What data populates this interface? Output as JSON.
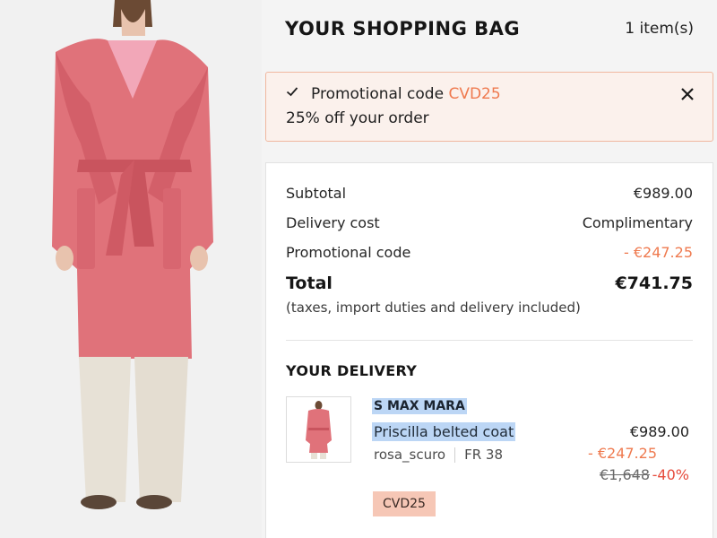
{
  "header": {
    "title": "YOUR SHOPPING BAG",
    "item_count": "1 item(s)"
  },
  "promo_banner": {
    "prefix": "Promotional code",
    "code": "CVD25",
    "description": "25% off your order",
    "icon": "check-icon",
    "close_icon": "close-icon"
  },
  "summary": {
    "subtotal_label": "Subtotal",
    "subtotal_value": "€989.00",
    "delivery_label": "Delivery cost",
    "delivery_value": "Complimentary",
    "promo_label": "Promotional code",
    "promo_value": "- €247.25",
    "total_label": "Total",
    "total_value": "€741.75",
    "tax_note": "(taxes, import duties and delivery included)"
  },
  "delivery": {
    "title": "YOUR DELIVERY",
    "item": {
      "brand": "S MAX MARA",
      "name": "Priscilla belted coat",
      "color": "rosa_scuro",
      "size": "FR 38",
      "price": "€989.00",
      "discount": "- €247.25",
      "original_price": "€1,648",
      "percent_off": "-40%",
      "promo_badge": "CVD25"
    }
  },
  "colors": {
    "accent": "#ef7a4f",
    "promo_border": "#f0b8a0",
    "promo_bg": "#fbf1ec",
    "highlight": "#bcd6f5",
    "badge_bg": "#f6c7b6",
    "coat": "#e0727a"
  }
}
